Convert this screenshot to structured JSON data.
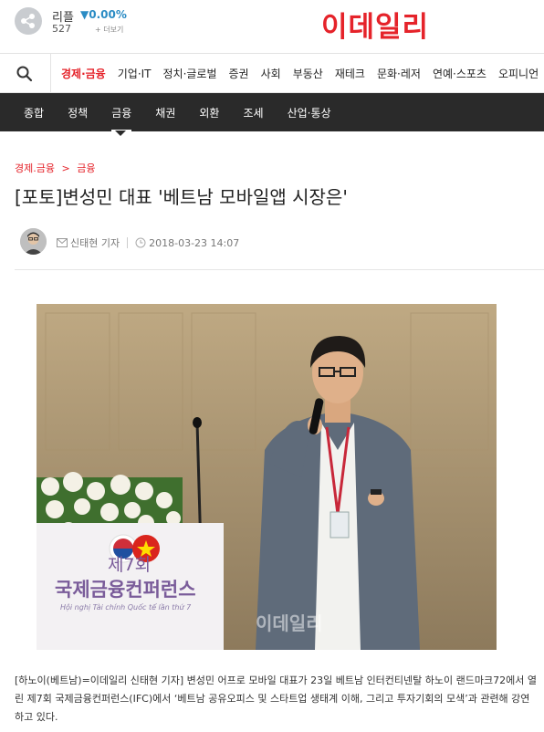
{
  "ticker": {
    "coin_name": "리플",
    "change": "▼0.00%",
    "price": "527",
    "more_label": "+ 더보기",
    "change_color": "#2b8cc4"
  },
  "brand": {
    "logo_text": "이데일리",
    "accent_color": "#e5232a"
  },
  "main_nav": {
    "search_icon": "search-icon",
    "items": [
      "경제·금융",
      "기업·IT",
      "정치·글로벌",
      "증권",
      "사회",
      "부동산",
      "재테크",
      "문화·레저",
      "연예·스포츠",
      "오피니언"
    ],
    "active_index": 0
  },
  "sub_nav": {
    "items": [
      "종합",
      "정책",
      "금융",
      "채권",
      "외환",
      "조세",
      "산업·통상"
    ],
    "active_index": 2
  },
  "breadcrumb": {
    "section": "경제.금융",
    "separator": ">",
    "subsection": "금융"
  },
  "article": {
    "title": "[포토]변성민 대표 '베트남 모바일앱 시장은'",
    "author": "신태현 기자",
    "date": "2018-03-23 14:07",
    "photo": {
      "podium_event_no": "제7회",
      "podium_event_name": "국제금융컨퍼런스",
      "podium_event_vn": "Hội nghị Tài chính Quốc tế lần thứ 7",
      "watermark": "이데일리"
    },
    "caption": "[하노이(베트남)=이데일리 신태현 기자] 변성민 어프로 모바일 대표가 23일 베트남 인터컨티넨탈 하노이 랜드마크72에서 열린 제7회 국제금융컨퍼런스(IFC)에서 ‘베트남 공유오피스 및 스타트업 생태계 이해, 그리고 투자기회의 모색’과 관련해 강연하고 있다."
  }
}
